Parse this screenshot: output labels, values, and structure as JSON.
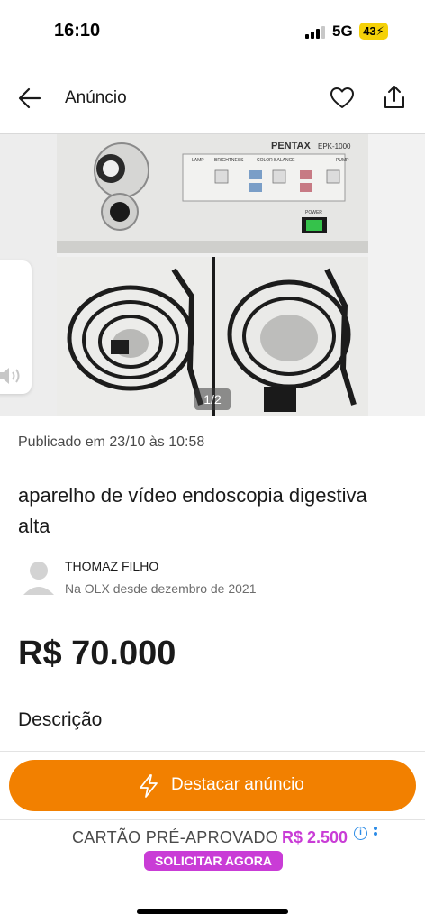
{
  "status_bar": {
    "time": "16:10",
    "network": "5G",
    "battery": "43"
  },
  "top_bar": {
    "title": "Anúncio"
  },
  "gallery": {
    "page_indicator": "1/2",
    "image_brand": "PENTAX",
    "image_model": "EPK-1000",
    "panel_labels": [
      "LAMP",
      "BRIGHTNESS",
      "COLOR BALANCE",
      "PUMP",
      "POWER"
    ]
  },
  "listing": {
    "published": "Publicado em 23/10 às 10:58",
    "title": "aparelho de vídeo endoscopia digestiva alta",
    "seller_name": "THOMAZ FILHO",
    "seller_since": "Na OLX desde dezembro de 2021",
    "price": "R$ 70.000",
    "description_heading": "Descrição"
  },
  "action": {
    "promote_label": "Destacar anúncio"
  },
  "banner": {
    "text": "CARTÃO PRÉ-APROVADO",
    "amount": "R$ 2.500",
    "info_glyph": "i",
    "cta": "SOLICITAR AGORA"
  },
  "colors": {
    "accent_orange": "#f28000",
    "banner_purple": "#c93cd6",
    "info_blue": "#2b8be6"
  },
  "icons": [
    "back-arrow-icon",
    "heart-icon",
    "share-icon",
    "speaker-icon",
    "avatar-icon",
    "bolt-icon",
    "info-icon",
    "more-vertical-icon"
  ]
}
